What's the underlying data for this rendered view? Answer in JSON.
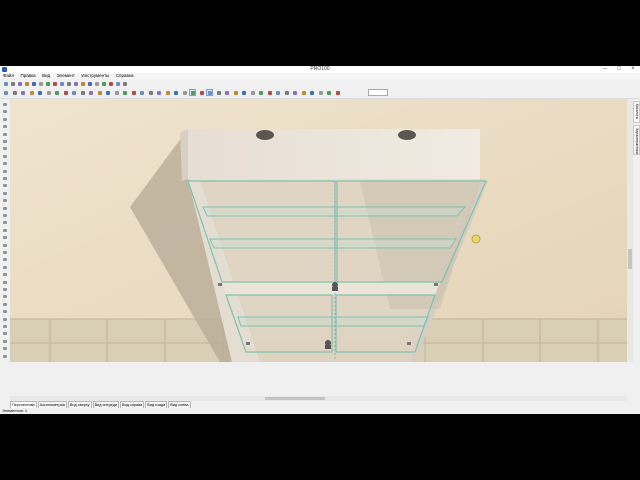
{
  "window": {
    "title": "PRO100"
  },
  "menu": [
    "Файл",
    "Правка",
    "Вид",
    "Элемент",
    "Инструменты",
    "Справка"
  ],
  "toolbar": {
    "icons": [
      "new-icon",
      "open-icon",
      "save-icon",
      "print-icon",
      "undo-icon",
      "redo-icon",
      "cut-icon",
      "copy-icon",
      "paste-icon",
      "delete-icon",
      "select-icon",
      "move-icon",
      "rotate-icon",
      "grid-icon",
      "render-icon",
      "view-icon",
      "zoom-in-icon",
      "zoom-out-icon",
      "light-icon",
      "texture-icon",
      "camera-icon",
      "walk-icon",
      "measure-icon",
      "report-icon"
    ]
  },
  "right_panel": {
    "tabs": [
      "Каталоги",
      "Характеристики"
    ]
  },
  "view_tabs": [
    "Перспектива",
    "Аксонометрия",
    "Вид сверху",
    "Вид спереди",
    "Вид справа",
    "Вид сзади",
    "Вид слева"
  ],
  "active_view_tab": "Перспектива",
  "status": {
    "text": "Элементов: 1"
  },
  "colors": {
    "floor": "#d8ccb3",
    "wall": "#eadcc4",
    "cabinet": "#ece5dc",
    "glass": "#bfe3d7"
  }
}
